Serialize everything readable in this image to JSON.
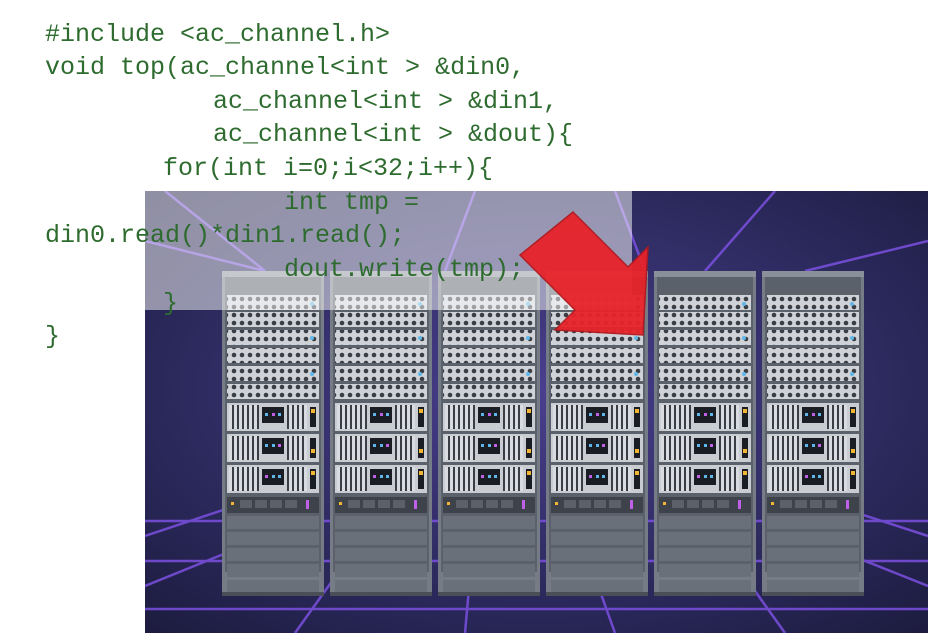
{
  "code": {
    "lines": [
      "#include <ac_channel.h>",
      "void top(ac_channel<int > &din0,",
      "ac_channel<int > &din1,",
      "ac_channel<int > &dout){",
      "for(int i=0;i<32;i++){",
      "int tmp =",
      "din0.read()*din1.read();",
      "dout.write(tmp);",
      "}",
      "}"
    ]
  },
  "illustration": {
    "subject": "server-racks",
    "rack_count": 6
  },
  "colors": {
    "code_text": "#2e6b2f",
    "background_dark": "#2a2858",
    "grid_lines": "#7b50e0",
    "rack_body": "#767c86",
    "arrow": "#e8232a"
  }
}
